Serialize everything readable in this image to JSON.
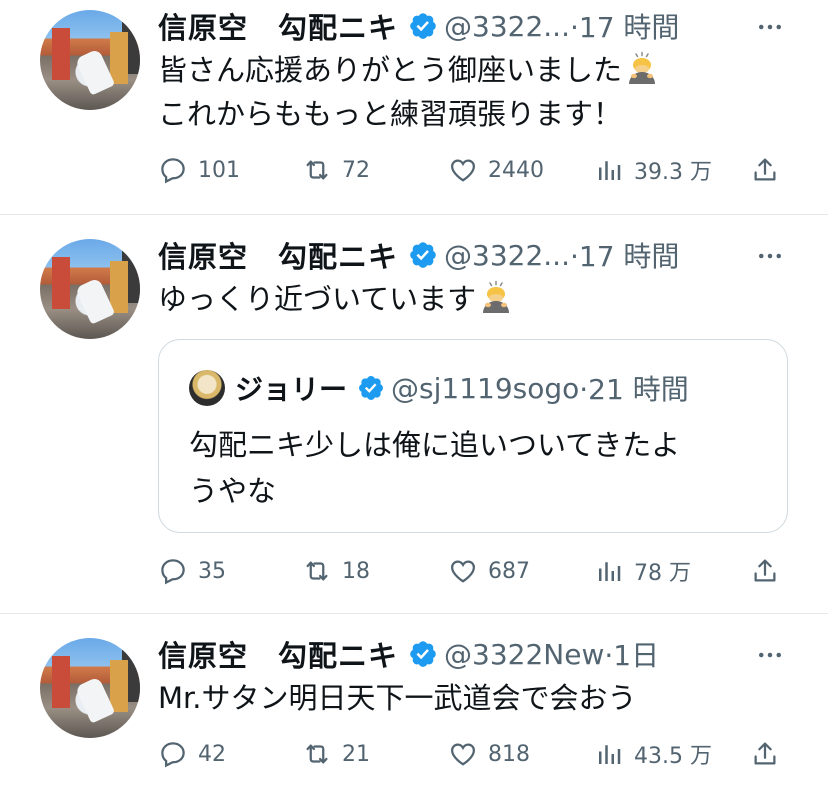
{
  "tweets": [
    {
      "name": "信原空　勾配ニキ",
      "handle": "@3322...",
      "time": "·17 時間",
      "lines": [
        "皆さん応援ありがとう御座いました",
        "これからももっと練習頑張ります！"
      ],
      "replies": "101",
      "retweets": "72",
      "likes": "2440",
      "views": "39.3 万"
    },
    {
      "name": "信原空　勾配ニキ",
      "handle": "@3322...",
      "time": "·17 時間",
      "lines": [
        "ゆっくり近づいています"
      ],
      "quote": {
        "name": "ジョリー",
        "handle": "@sj1119sogo",
        "time": "·21 時間",
        "lines": [
          "勾配ニキ少しは俺に追いついてきたよ",
          "うやな"
        ]
      },
      "replies": "35",
      "retweets": "18",
      "likes": "687",
      "views": "78 万"
    },
    {
      "name": "信原空　勾配ニキ",
      "handle": "@3322New",
      "time": "·1日",
      "lines": [
        "Mr.サタン明日天下一武道会で会おう"
      ],
      "replies": "42",
      "retweets": "21",
      "likes": "818",
      "views": "43.5 万"
    }
  ],
  "icons": {
    "verified": "verified-badge-icon",
    "emoji": "person-bowing-emoji",
    "reply": "reply-icon",
    "retweet": "retweet-icon",
    "like": "heart-icon",
    "views": "views-icon",
    "share": "share-icon",
    "more": "more-icon"
  },
  "colors": {
    "verified": "#1d9bf0",
    "muted": "#536471",
    "text": "#0f1419",
    "border": "#cfd9de"
  }
}
